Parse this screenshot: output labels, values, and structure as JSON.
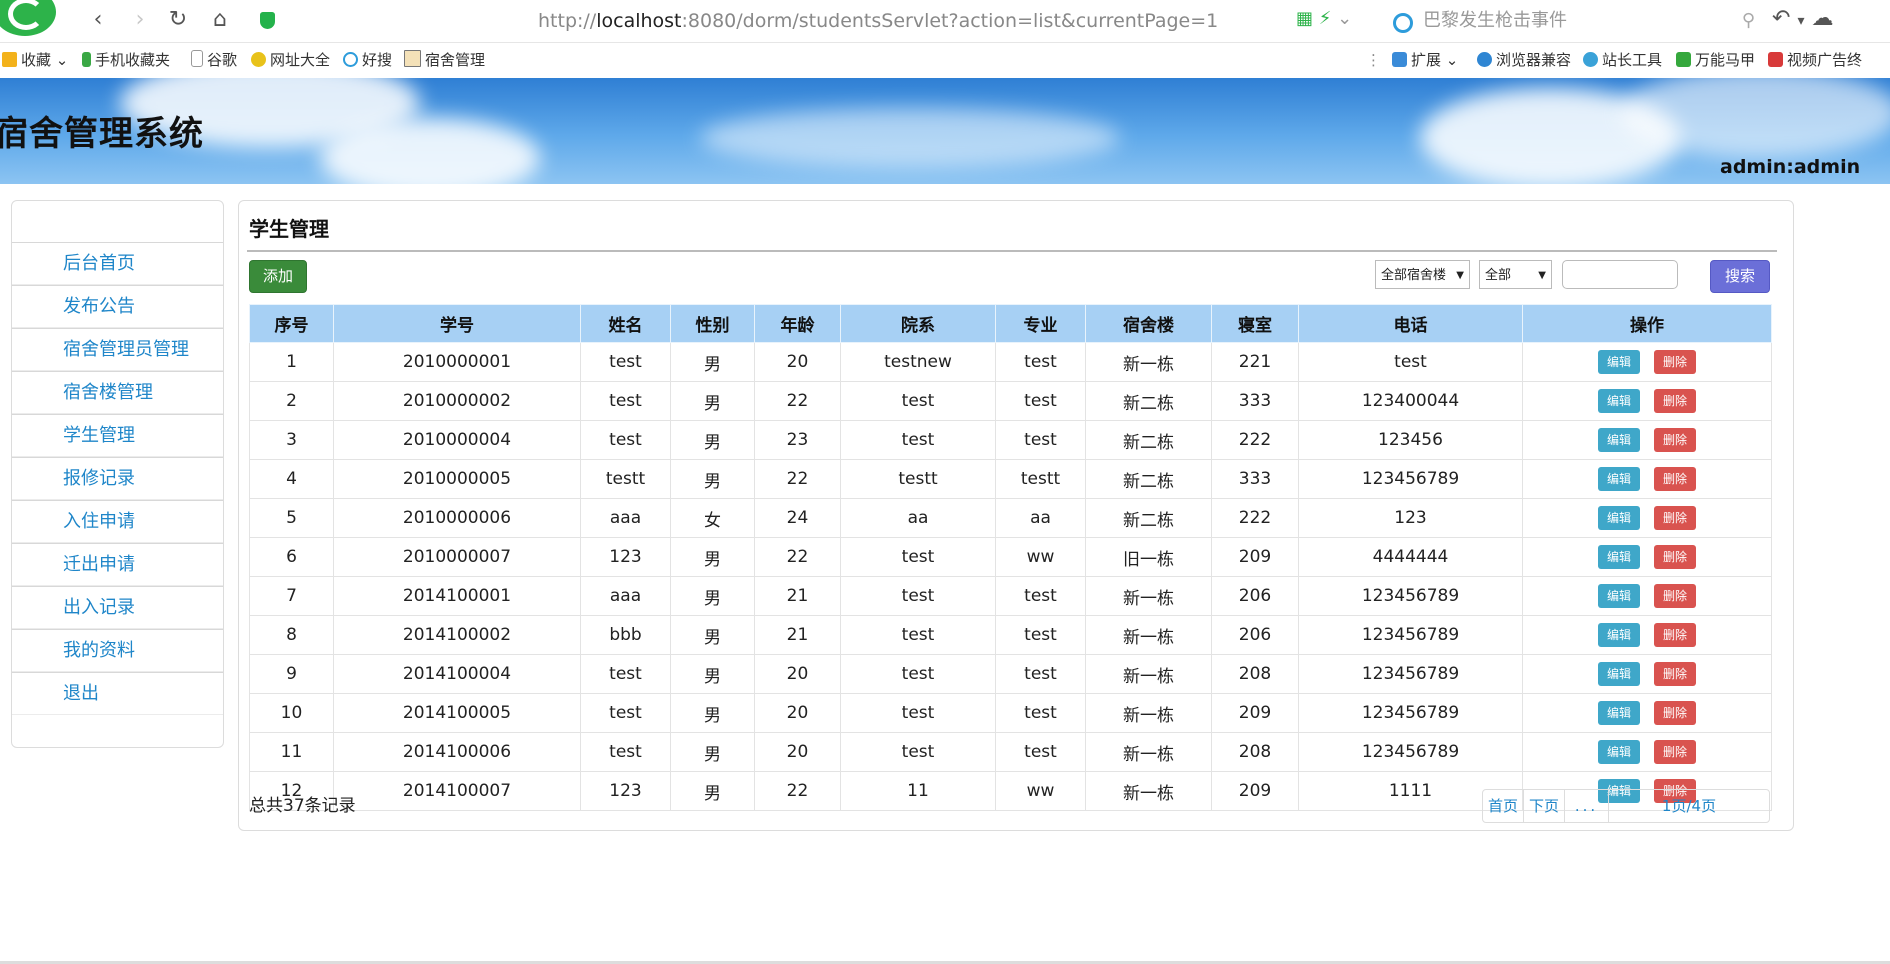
{
  "browser": {
    "url_prefix": "http://",
    "url_host": "localhost",
    "url_rest": ":8080/dorm/studentsServlet?action=list&currentPage=1",
    "search_placeholder": "巴黎发生枪击事件",
    "bookmarks": [
      "收藏",
      "手机收藏夹",
      "谷歌",
      "网址大全",
      "好搜",
      "宿舍管理"
    ],
    "extensions": [
      "扩展",
      "浏览器兼容",
      "站长工具",
      "万能马甲",
      "视频广告终"
    ]
  },
  "banner": {
    "title": "宿舍管理系统",
    "user": "admin:admin"
  },
  "sidebar": {
    "items": [
      "后台首页",
      "发布公告",
      "宿舍管理员管理",
      "宿舍楼管理",
      "学生管理",
      "报修记录",
      "入住申请",
      "迁出申请",
      "出入记录",
      "我的资料",
      "退出"
    ]
  },
  "main": {
    "title": "学生管理",
    "add_label": "添加",
    "building_filter": "全部宿舍楼",
    "field_filter": "全部",
    "search_label": "搜索",
    "search_value": "",
    "columns": [
      "序号",
      "学号",
      "姓名",
      "性别",
      "年龄",
      "院系",
      "专业",
      "宿舍楼",
      "寝室",
      "电话",
      "操作"
    ],
    "rows": [
      [
        "1",
        "2010000001",
        "test",
        "男",
        "20",
        "testnew",
        "test",
        "新一栋",
        "221",
        "test"
      ],
      [
        "2",
        "2010000002",
        "test",
        "男",
        "22",
        "test",
        "test",
        "新二栋",
        "333",
        "123400044"
      ],
      [
        "3",
        "2010000004",
        "test",
        "男",
        "23",
        "test",
        "test",
        "新二栋",
        "222",
        "123456"
      ],
      [
        "4",
        "2010000005",
        "testt",
        "男",
        "22",
        "testt",
        "testt",
        "新二栋",
        "333",
        "123456789"
      ],
      [
        "5",
        "2010000006",
        "aaa",
        "女",
        "24",
        "aa",
        "aa",
        "新二栋",
        "222",
        "123"
      ],
      [
        "6",
        "2010000007",
        "123",
        "男",
        "22",
        "test",
        "ww",
        "旧一栋",
        "209",
        "4444444"
      ],
      [
        "7",
        "2014100001",
        "aaa",
        "男",
        "21",
        "test",
        "test",
        "新一栋",
        "206",
        "123456789"
      ],
      [
        "8",
        "2014100002",
        "bbb",
        "男",
        "21",
        "test",
        "test",
        "新一栋",
        "206",
        "123456789"
      ],
      [
        "9",
        "2014100004",
        "test",
        "男",
        "20",
        "test",
        "test",
        "新一栋",
        "208",
        "123456789"
      ],
      [
        "10",
        "2014100005",
        "test",
        "男",
        "20",
        "test",
        "test",
        "新一栋",
        "209",
        "123456789"
      ],
      [
        "11",
        "2014100006",
        "test",
        "男",
        "20",
        "test",
        "test",
        "新一栋",
        "208",
        "123456789"
      ],
      [
        "12",
        "2014100007",
        "123",
        "男",
        "22",
        "11",
        "ww",
        "新一栋",
        "209",
        "1111"
      ]
    ],
    "edit_label": "编辑",
    "delete_label": "删除",
    "total": "总共37条记录",
    "pager": {
      "first": "首页",
      "next": "下页",
      "ellipsis": "...",
      "current": "1页/4页"
    }
  }
}
